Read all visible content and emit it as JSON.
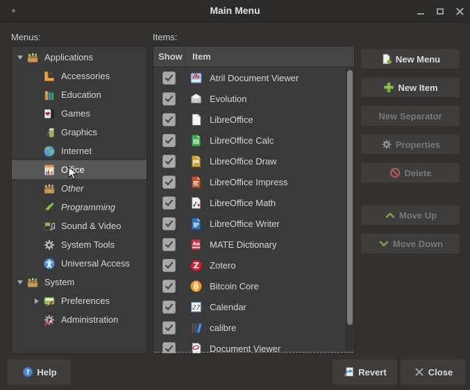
{
  "window": {
    "title": "Main Menu",
    "controls": [
      {
        "name": "minimize-button",
        "icon": "minimize-icon"
      },
      {
        "name": "maximize-button",
        "icon": "maximize-icon"
      },
      {
        "name": "window-close-button",
        "icon": "window-close-icon"
      }
    ]
  },
  "colors": {
    "window_bg": "#333130",
    "panel_bg": "#3a3a3a",
    "selection_gray": "#575757",
    "accent_green": "#86b84a",
    "help_blue": "#4a86c8",
    "delete_red": "#a85a4e"
  },
  "menus_panel": {
    "label": "Menus:",
    "tree": [
      {
        "label": "Applications",
        "icon": "applications-folder-icon",
        "depth": 0,
        "expander": "expanded"
      },
      {
        "label": "Accessories",
        "icon": "accessories-icon",
        "depth": 1
      },
      {
        "label": "Education",
        "icon": "education-icon",
        "depth": 1
      },
      {
        "label": "Games",
        "icon": "games-icon",
        "depth": 1
      },
      {
        "label": "Graphics",
        "icon": "graphics-icon",
        "depth": 1
      },
      {
        "label": "Internet",
        "icon": "internet-icon",
        "depth": 1
      },
      {
        "label": "Office",
        "icon": "office-icon",
        "depth": 1,
        "selected": true
      },
      {
        "label": "Other",
        "icon": "other-folder-icon",
        "depth": 1,
        "italic": true
      },
      {
        "label": "Programming",
        "icon": "programming-icon",
        "depth": 1,
        "italic": true
      },
      {
        "label": "Sound & Video",
        "icon": "sound-video-icon",
        "depth": 1
      },
      {
        "label": "System Tools",
        "icon": "system-tools-icon",
        "depth": 1
      },
      {
        "label": "Universal Access",
        "icon": "universal-access-icon",
        "depth": 1
      },
      {
        "label": "System",
        "icon": "system-folder-icon",
        "depth": 0,
        "expander": "expanded"
      },
      {
        "label": "Preferences",
        "icon": "preferences-icon",
        "depth": 1,
        "expander": "collapsed"
      },
      {
        "label": "Administration",
        "icon": "administration-icon",
        "depth": 1
      }
    ]
  },
  "items_panel": {
    "label": "Items:",
    "columns": [
      "Show",
      "Item"
    ],
    "rows": [
      {
        "name": "Atril Document Viewer",
        "icon": "atril-icon",
        "checked": true
      },
      {
        "name": "Evolution",
        "icon": "evolution-icon",
        "checked": true
      },
      {
        "name": "LibreOffice",
        "icon": "libreoffice-icon",
        "checked": true
      },
      {
        "name": "LibreOffice Calc",
        "icon": "libreoffice-calc-icon",
        "checked": true
      },
      {
        "name": "LibreOffice Draw",
        "icon": "libreoffice-draw-icon",
        "checked": true
      },
      {
        "name": "LibreOffice Impress",
        "icon": "libreoffice-impress-icon",
        "checked": true
      },
      {
        "name": "LibreOffice Math",
        "icon": "libreoffice-math-icon",
        "checked": true
      },
      {
        "name": "LibreOffice Writer",
        "icon": "libreoffice-writer-icon",
        "checked": true
      },
      {
        "name": "MATE Dictionary",
        "icon": "mate-dictionary-icon",
        "checked": true
      },
      {
        "name": "Zotero",
        "icon": "zotero-icon",
        "checked": true
      },
      {
        "name": "Bitcoin Core",
        "icon": "bitcoin-icon",
        "checked": true
      },
      {
        "name": "Calendar",
        "icon": "calendar-icon",
        "checked": true
      },
      {
        "name": "calibre",
        "icon": "calibre-icon",
        "checked": true
      },
      {
        "name": "Document Viewer",
        "icon": "document-viewer-icon",
        "checked": true
      }
    ]
  },
  "actions": [
    {
      "label": "New Menu",
      "icon": "new-menu-icon",
      "enabled": true
    },
    {
      "label": "New Item",
      "icon": "new-item-icon",
      "enabled": true
    },
    {
      "label": "New Separator",
      "icon": null,
      "enabled": false
    },
    {
      "label": "Properties",
      "icon": "properties-icon",
      "enabled": false
    },
    {
      "label": "Delete",
      "icon": "delete-icon",
      "enabled": false
    },
    {
      "label": "Move Up",
      "icon": "move-up-icon",
      "enabled": false,
      "gap_before": true
    },
    {
      "label": "Move Down",
      "icon": "move-down-icon",
      "enabled": false
    }
  ],
  "footer": {
    "help": {
      "label": "Help",
      "icon": "help-icon"
    },
    "revert": {
      "label": "Revert",
      "icon": "revert-icon"
    },
    "close": {
      "label": "Close",
      "icon": "close-icon"
    }
  }
}
